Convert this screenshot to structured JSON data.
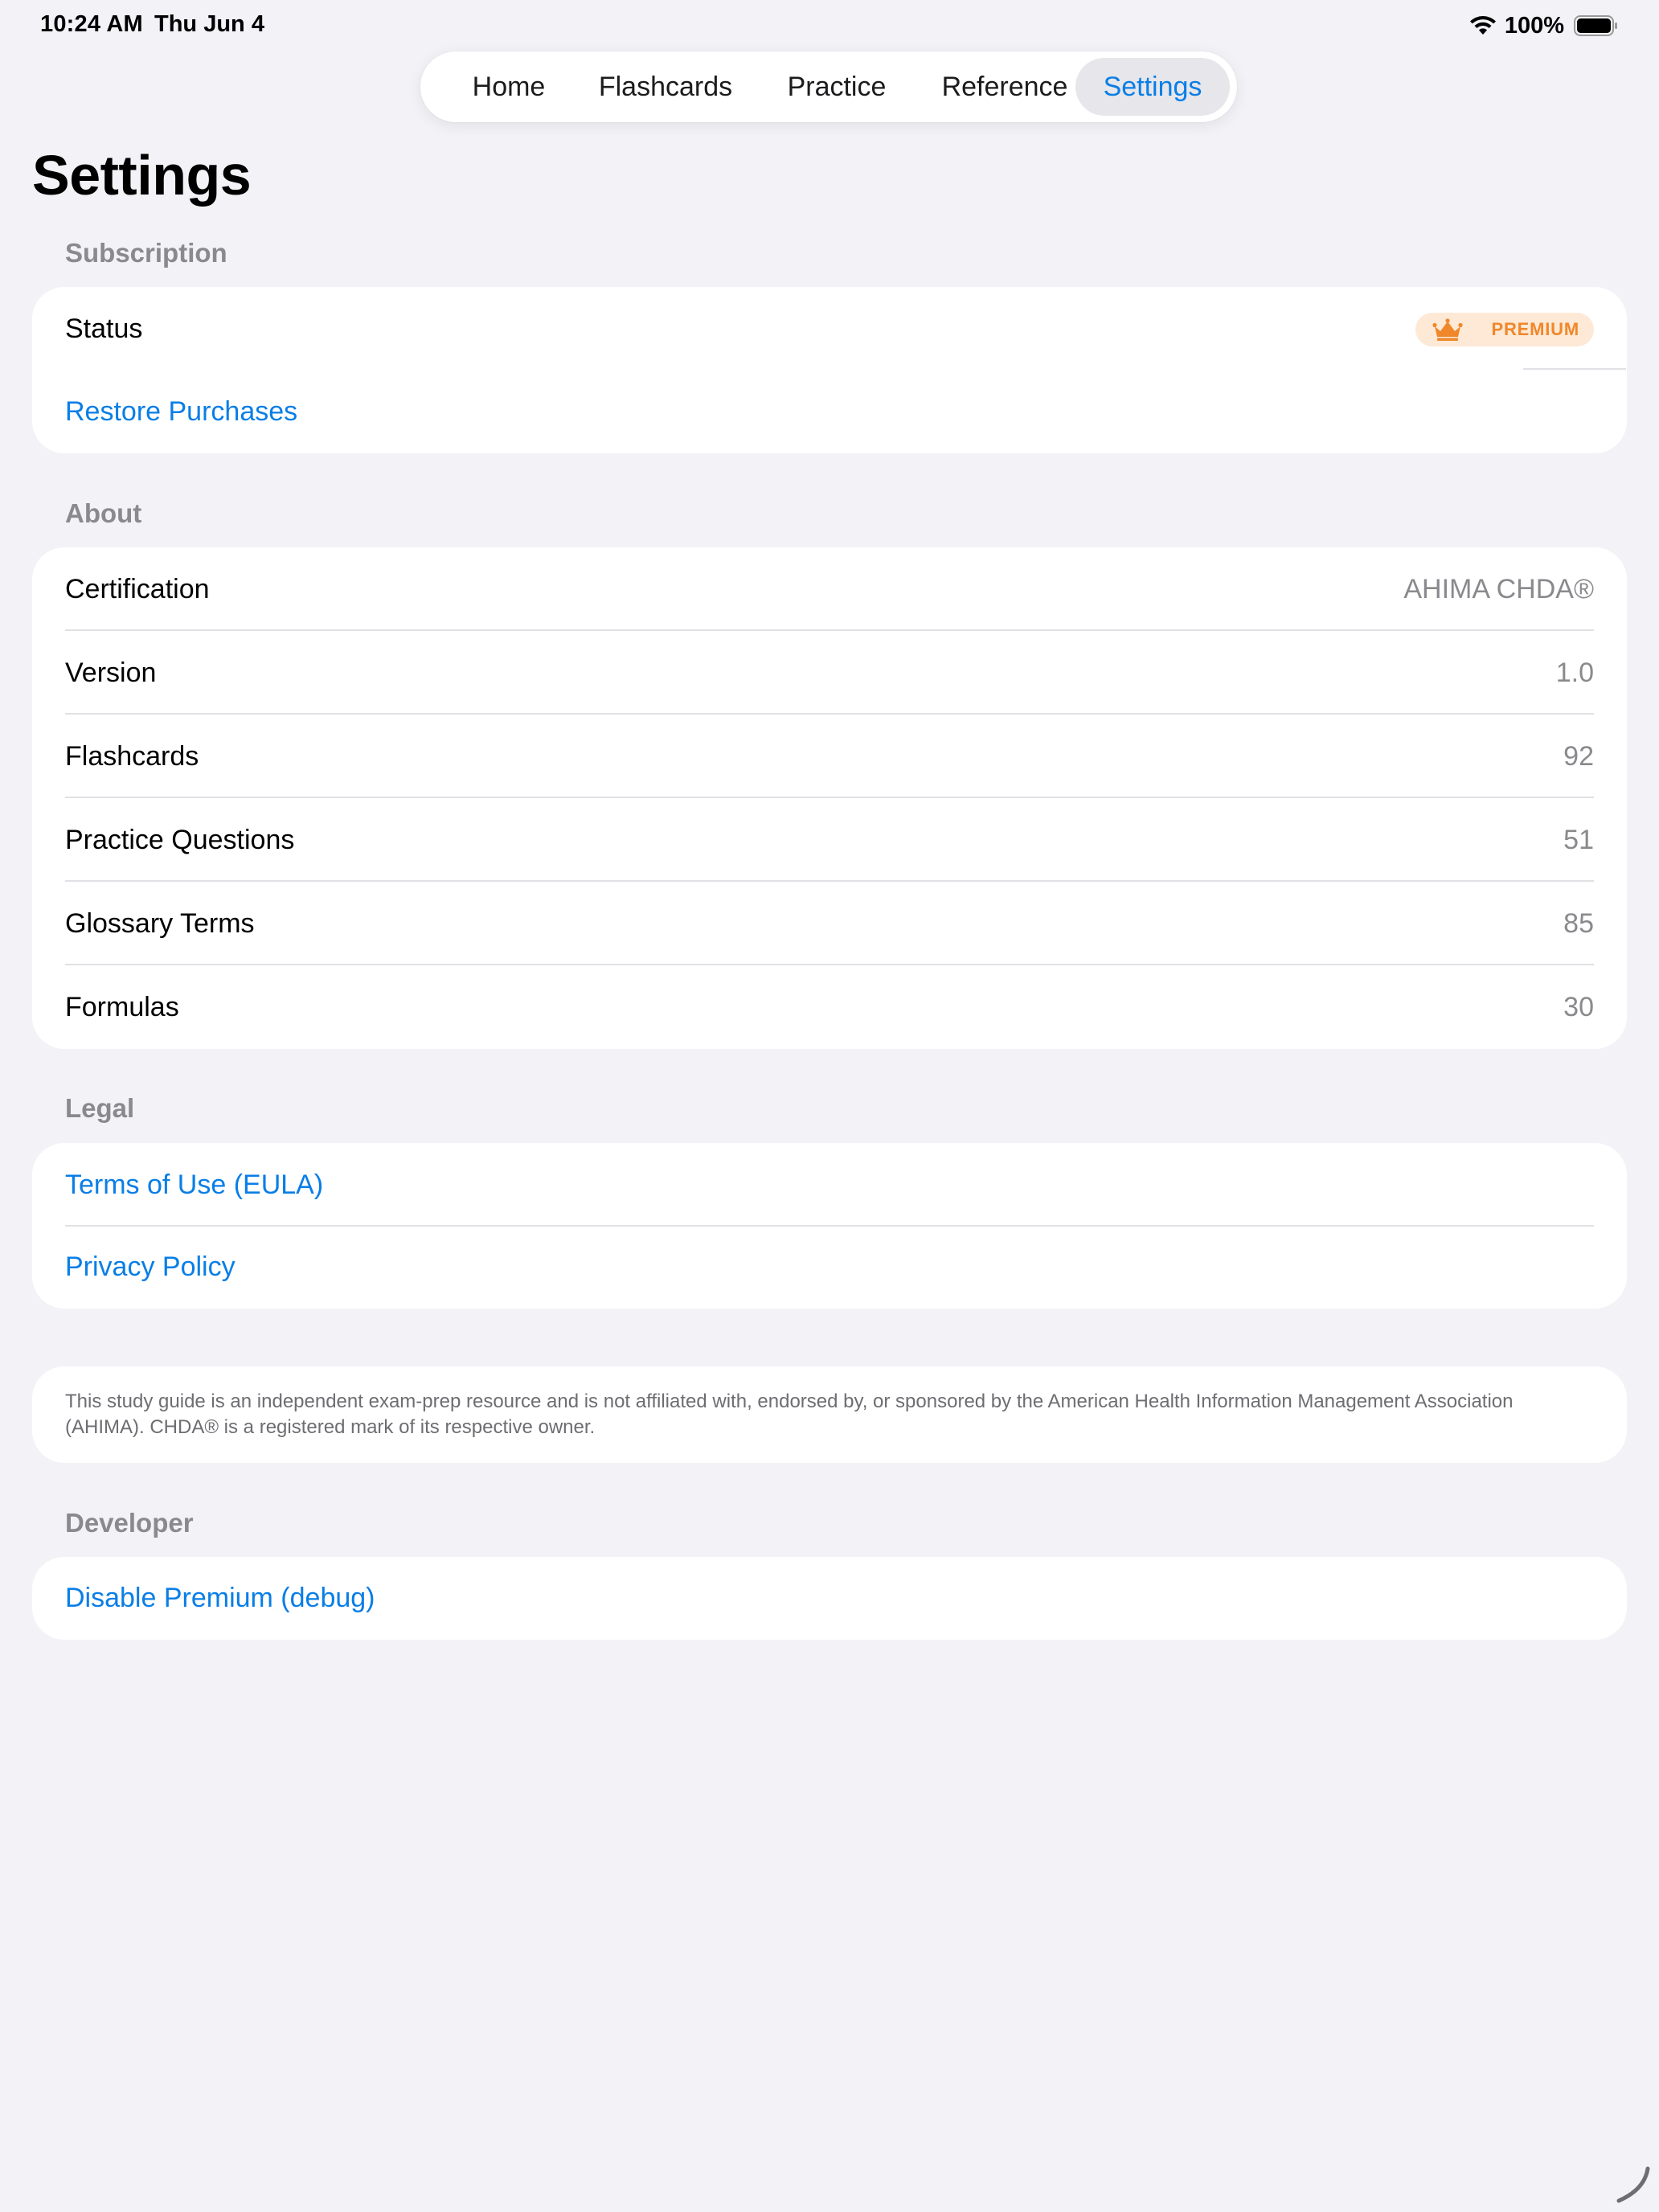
{
  "status_bar": {
    "time": "10:24 AM",
    "date": "Thu Jun 4",
    "battery": "100%"
  },
  "tabs": [
    {
      "label": "Home",
      "active": false
    },
    {
      "label": "Flashcards",
      "active": false
    },
    {
      "label": "Practice",
      "active": false
    },
    {
      "label": "Reference",
      "active": false
    },
    {
      "label": "Settings",
      "active": true
    }
  ],
  "page_title": "Settings",
  "subscription": {
    "header": "Subscription",
    "status_label": "Status",
    "badge_text": "PREMIUM",
    "restore_label": "Restore Purchases"
  },
  "about": {
    "header": "About",
    "rows": [
      {
        "label": "Certification",
        "value": "AHIMA CHDA®"
      },
      {
        "label": "Version",
        "value": "1.0"
      },
      {
        "label": "Flashcards",
        "value": "92"
      },
      {
        "label": "Practice Questions",
        "value": "51"
      },
      {
        "label": "Glossary Terms",
        "value": "85"
      },
      {
        "label": "Formulas",
        "value": "30"
      }
    ]
  },
  "legal": {
    "header": "Legal",
    "terms_label": "Terms of Use (EULA)",
    "privacy_label": "Privacy Policy"
  },
  "disclaimer": "This study guide is an independent exam-prep resource and is not affiliated with, endorsed by, or sponsored by the American Health Information Management Association (AHIMA). CHDA® is a registered mark of its respective owner.",
  "developer": {
    "header": "Developer",
    "disable_premium_label": "Disable Premium (debug)"
  },
  "colors": {
    "accent": "#0a7ee6",
    "premium": "#f0872a",
    "background": "#f2f2f7"
  },
  "icons": {
    "wifi": "wifi-icon",
    "battery": "battery-icon",
    "crown": "crown-icon"
  }
}
